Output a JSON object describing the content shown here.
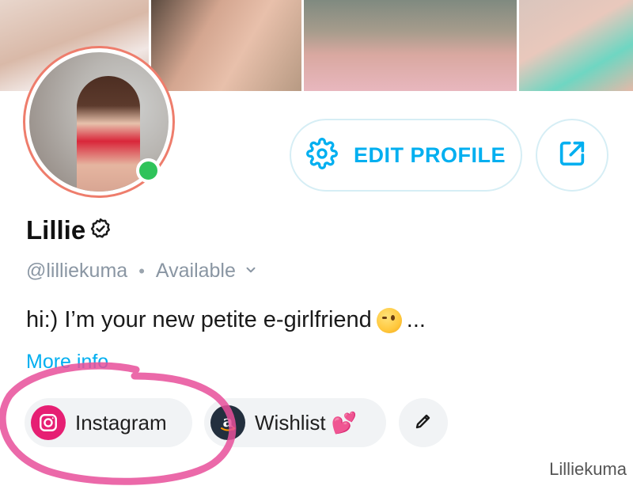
{
  "profile": {
    "name": "Lillie",
    "handle": "@lilliekuma",
    "status": "Available",
    "bio": "hi:) I’m your new petite e-girlfriend",
    "bio_ellipsis": "...",
    "more_info": "More info"
  },
  "actions": {
    "edit_profile": "EDIT PROFILE"
  },
  "links": [
    {
      "label": "Instagram",
      "icon": "instagram-icon"
    },
    {
      "label": "Wishlist",
      "icon": "amazon-icon",
      "emoji": "💕"
    }
  ],
  "watermark": "Lilliekuma",
  "colors": {
    "accent": "#00aff0",
    "online": "#2fc35a",
    "avatar_ring": "#ee7d6c",
    "instagram": "#e61f73",
    "annotation": "#e84f9a"
  },
  "icons": {
    "verified": "verified-badge-icon",
    "settings": "gear-icon",
    "share": "share-icon",
    "status_dropdown": "chevron-down-icon",
    "edit_links": "pencil-icon"
  }
}
